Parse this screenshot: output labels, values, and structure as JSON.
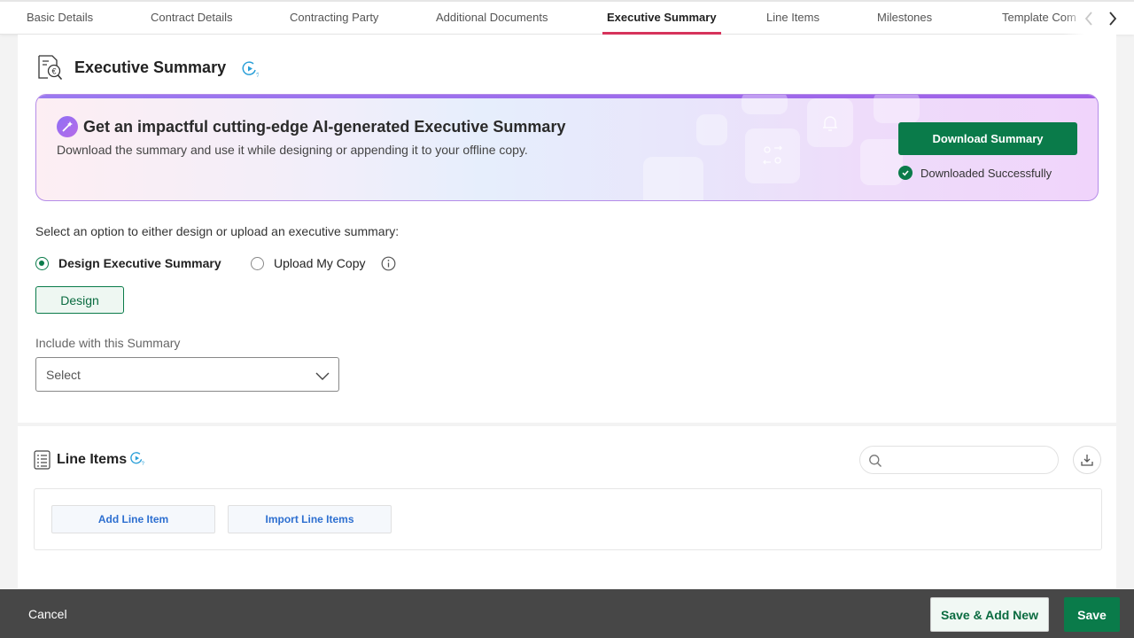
{
  "tabs": [
    {
      "label": "Basic Details",
      "active": false
    },
    {
      "label": "Contract Details",
      "active": false
    },
    {
      "label": "Contracting Party",
      "active": false
    },
    {
      "label": "Additional Documents",
      "active": false
    },
    {
      "label": "Executive Summary",
      "active": true
    },
    {
      "label": "Line Items",
      "active": false
    },
    {
      "label": "Milestones",
      "active": false
    },
    {
      "label": "Template Com",
      "active": false
    }
  ],
  "executive_summary": {
    "title": "Executive Summary",
    "banner": {
      "title": "Get an impactful cutting-edge AI-generated Executive Summary",
      "subtitle": "Download the summary and use it while designing or appending it to your offline copy.",
      "download_button": "Download Summary",
      "status": "Downloaded Successfully"
    },
    "prompt": "Select an option to either design or upload an executive summary:",
    "options": [
      {
        "label": "Design Executive Summary",
        "selected": true
      },
      {
        "label": "Upload My Copy",
        "selected": false
      }
    ],
    "design_button": "Design",
    "include_label": "Include with this Summary",
    "include_select": "Select"
  },
  "line_items": {
    "title": "Line Items",
    "search_placeholder": "",
    "add_button": "Add Line Item",
    "import_button": "Import Line Items"
  },
  "footer": {
    "cancel": "Cancel",
    "save_add": "Save & Add New",
    "save": "Save"
  },
  "colors": {
    "primary_green": "#0a7b4a",
    "active_tab_underline": "#d6335b",
    "link_blue": "#2d6fd0",
    "footer_bg": "#474747"
  }
}
